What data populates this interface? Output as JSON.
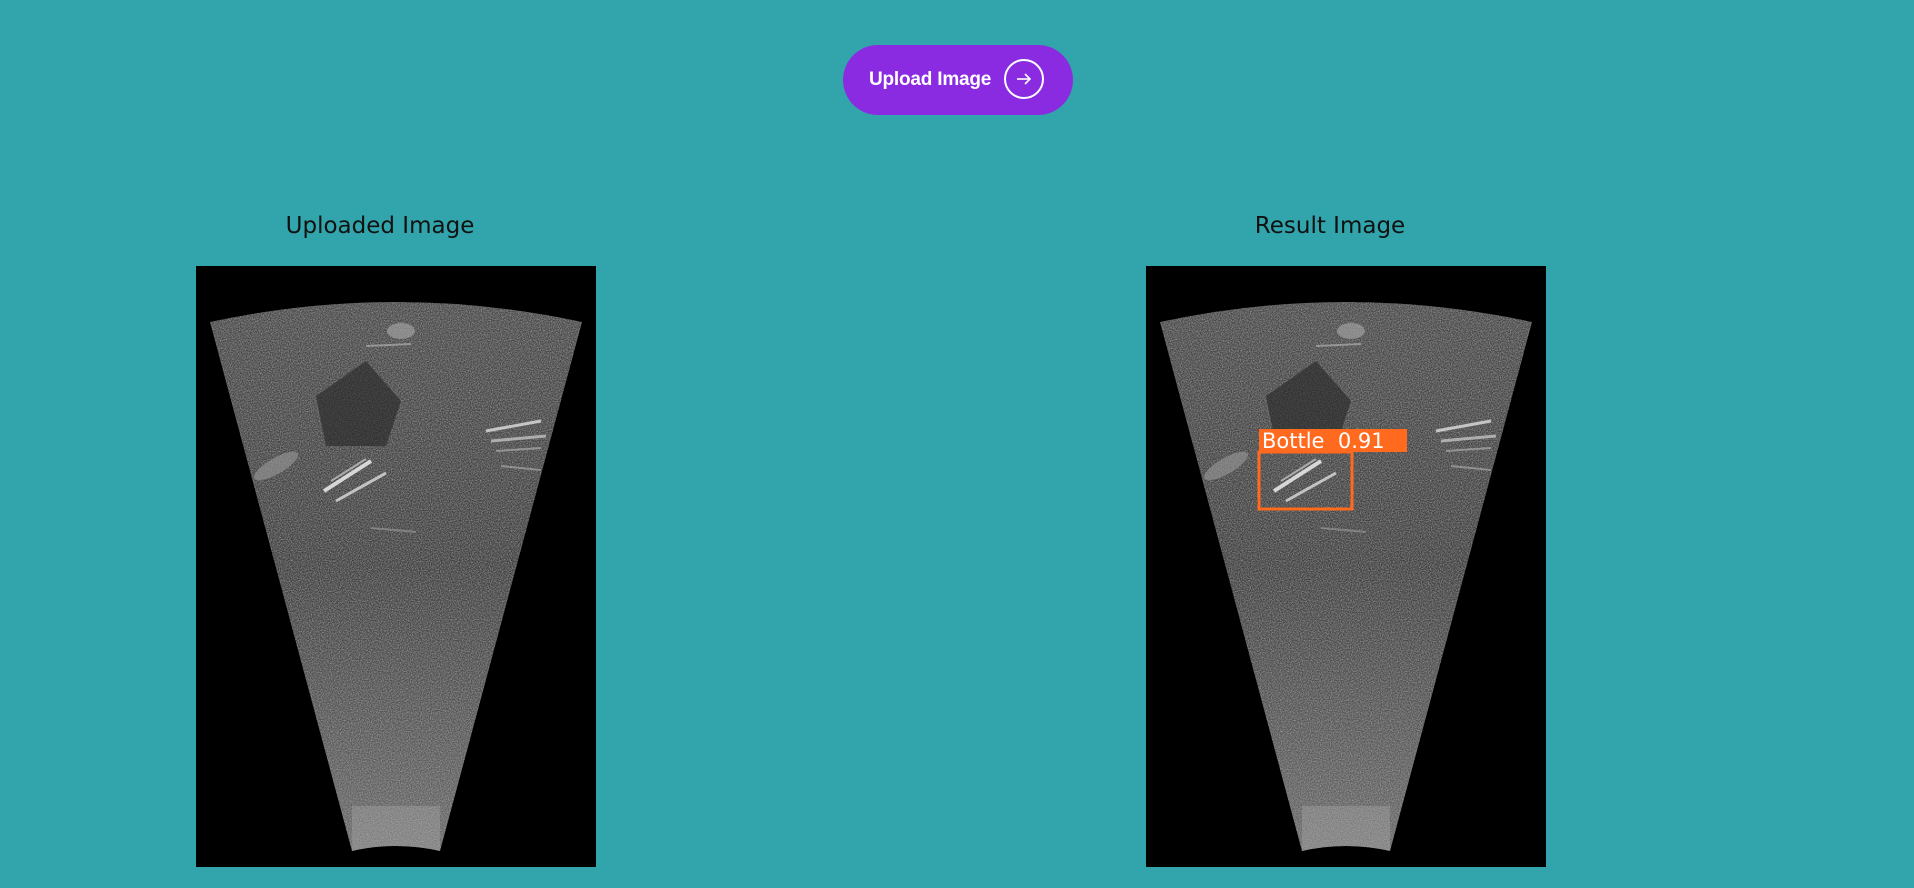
{
  "upload": {
    "label": "Upload Image",
    "icon": "arrow-right-icon",
    "color": "#8a2be2"
  },
  "page": {
    "background": "#31a5ab"
  },
  "panels": {
    "uploaded": {
      "title": "Uploaded Image"
    },
    "result": {
      "title": "Result Image",
      "detection": {
        "label": "Bottle  0.91",
        "color": "#ff6a1f"
      }
    }
  }
}
